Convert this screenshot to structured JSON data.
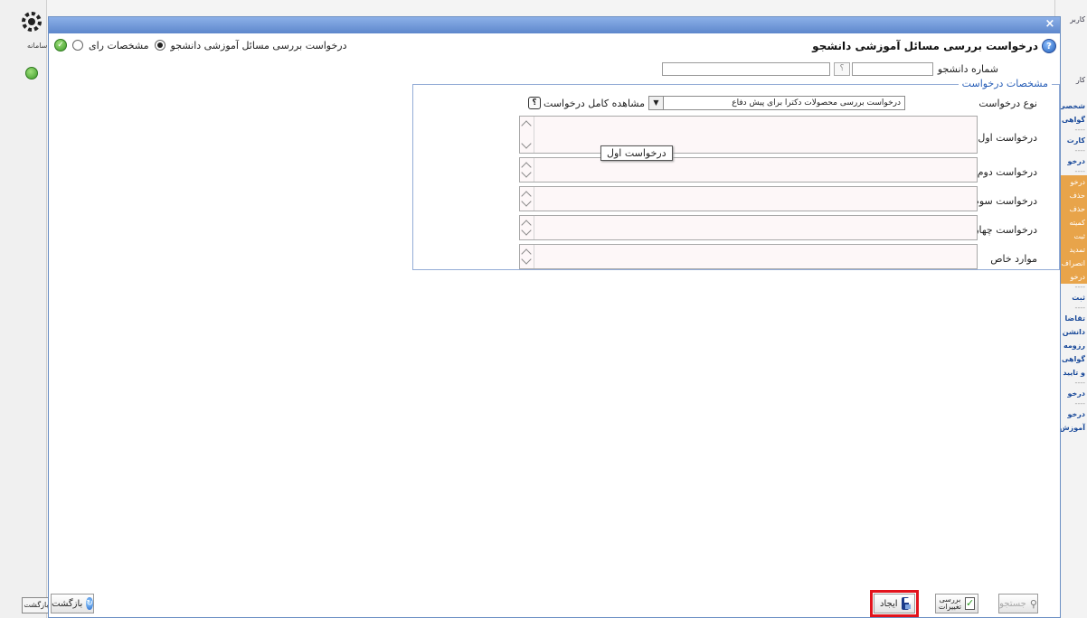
{
  "dialog": {
    "title": "درخواست بررسی مسائل آموزشی دانشجو",
    "close_symbol": "×"
  },
  "radios": {
    "option1": "درخواست بررسی مسائل آموزشی دانشجو",
    "option2": "مشخصات رای"
  },
  "student": {
    "label": "شماره دانشجو",
    "lookup": "؟"
  },
  "fieldset": {
    "legend": "مشخصات درخواست",
    "type_label": "نوع درخواست",
    "type_value": "درخواست بررسی محصولات دکترا برای پیش دفاع",
    "full_view": "مشاهده کامل درخواست",
    "full_view_icon": "؟",
    "req1": "درخواست اول",
    "req2": "درخواست دوم",
    "req3": "درخواست سوم",
    "req4": "درخواست چهارم",
    "special": "موارد خاص"
  },
  "tooltip": "درخواست اول",
  "footer": {
    "create": "ایجاد",
    "review": "بررسی تغییرات",
    "search": "جستجو",
    "back": "بازگشت"
  },
  "outer": {
    "back": "بازگشت",
    "logo_caption": "سامانه"
  },
  "bg_menu": [
    "کاربر",
    "کار",
    "شخصی",
    "گواهی",
    "کارت",
    "درخو",
    "درخو",
    "حذف",
    "حذف",
    "کمیته",
    "ثبت",
    "تمدید",
    "انصراف",
    "درخو",
    "ثبت",
    "تقاضا",
    "دانشن",
    "رزومه",
    "گواهی",
    "و تایید",
    "درخو",
    "درخو",
    "آموزش"
  ],
  "colors": {
    "accent": "#2a60b8",
    "highlight": "#e2141d"
  }
}
